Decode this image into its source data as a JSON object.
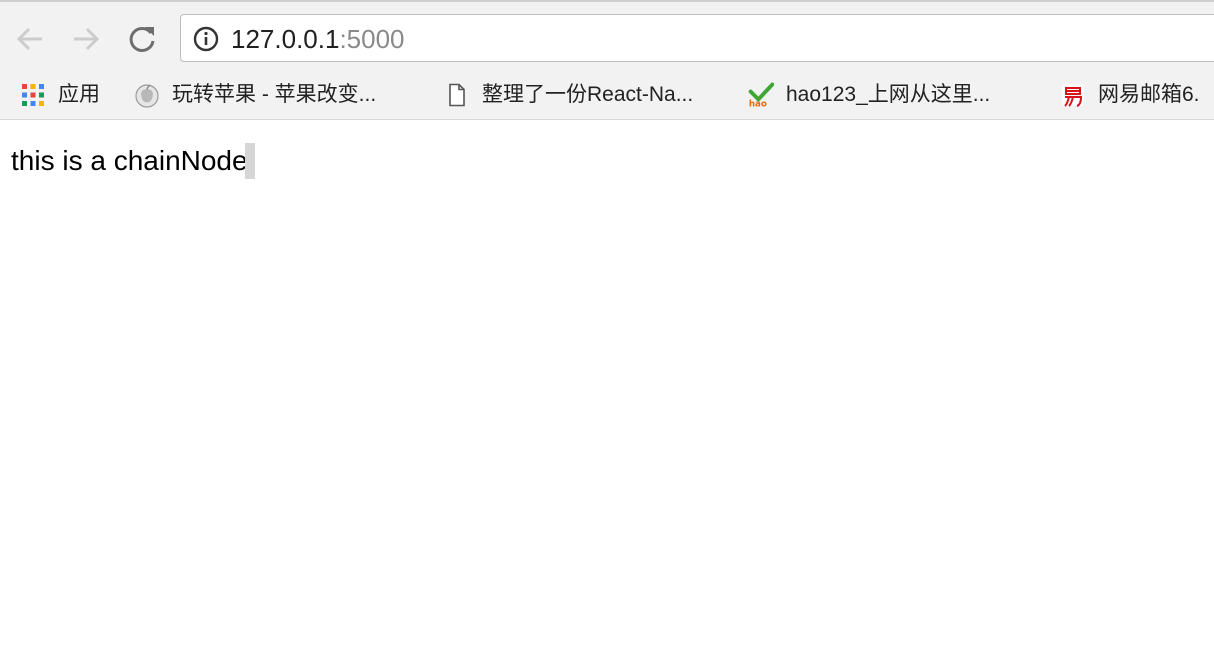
{
  "browser": {
    "url_host": "127.0.0.1",
    "url_port": ":5000"
  },
  "bookmarks": [
    {
      "label": "应用",
      "icon": "apps-grid-icon"
    },
    {
      "label": "玩转苹果 - 苹果改变...",
      "icon": "apple-favicon-icon"
    },
    {
      "label": "整理了一份React-Na...",
      "icon": "page-icon"
    },
    {
      "label": "hao123_上网从这里...",
      "icon": "hao123-logo-icon"
    },
    {
      "label": "网易邮箱6.",
      "icon": "netease-mail-icon"
    }
  ],
  "page": {
    "text": "this is a chainNode!"
  },
  "colors": {
    "toolbar_bg": "#f2f2f2",
    "url_port": "#8a8a8a",
    "nav_disabled": "#cccccc",
    "nav_enabled": "#6e6e6e"
  }
}
